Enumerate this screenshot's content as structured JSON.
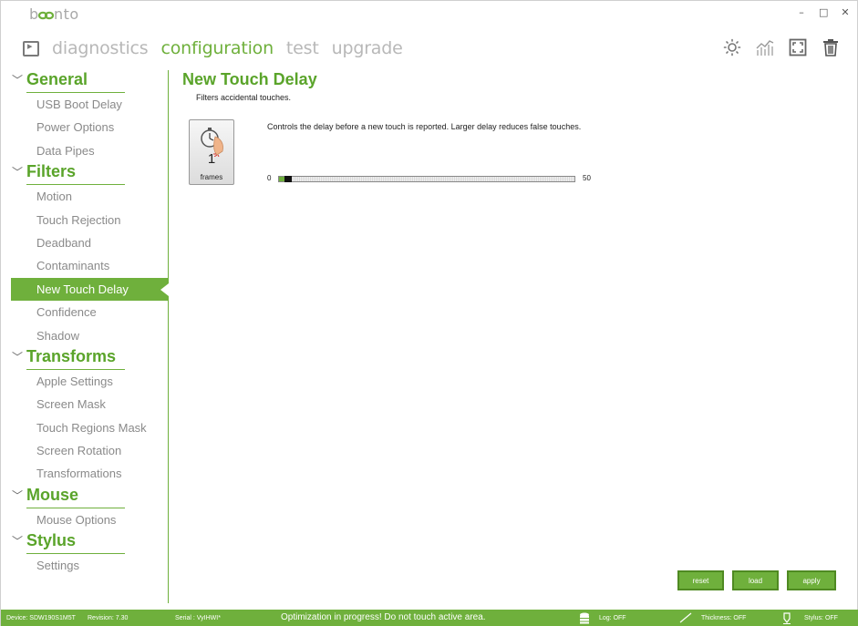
{
  "app": {
    "logo": "beento",
    "window_controls": {
      "minimize": "–",
      "maximize": "□",
      "close": "✕"
    }
  },
  "nav": {
    "tabs": [
      {
        "label": "diagnostics",
        "active": false
      },
      {
        "label": "configuration",
        "active": true
      },
      {
        "label": "test",
        "active": false
      },
      {
        "label": "upgrade",
        "active": false
      }
    ],
    "toolbar_icons": [
      "brightness-icon",
      "signal-chart-icon",
      "fullscreen-icon",
      "trash-icon"
    ]
  },
  "sidebar": {
    "groups": [
      {
        "title": "General",
        "items": [
          "USB Boot Delay",
          "Power Options",
          "Data Pipes"
        ]
      },
      {
        "title": "Filters",
        "items": [
          "Motion",
          "Touch Rejection",
          "Deadband",
          "Contaminants",
          "New Touch Delay",
          "Confidence",
          "Shadow"
        ]
      },
      {
        "title": "Transforms",
        "items": [
          "Apple Settings",
          "Screen Mask",
          "Touch Regions Mask",
          "Screen Rotation",
          "Transformations"
        ]
      },
      {
        "title": "Mouse",
        "items": [
          "Mouse Options"
        ]
      },
      {
        "title": "Stylus",
        "items": [
          "Settings"
        ]
      }
    ],
    "active_item": "New Touch Delay"
  },
  "page": {
    "title": "New Touch Delay",
    "subtitle": "Filters accidental touches.",
    "setting": {
      "value": "1",
      "unit": "frames",
      "description": "Controls the delay before a new touch is reported.  Larger delay reduces false touches.",
      "slider_min": "0",
      "slider_max": "50",
      "slider_value": 1
    }
  },
  "actions": {
    "reset": "reset",
    "load": "load",
    "apply": "apply"
  },
  "status": {
    "device": "Device: SDW190S1M5T",
    "revision": "Revision: 7.30",
    "serial": "Serial : VyIHWI*",
    "message": "Optimization in progress! Do not touch active area.",
    "log": "Log: OFF",
    "thickness": "Thickness: OFF",
    "stylus": "Stylus: OFF"
  },
  "colors": {
    "accent": "#6fb03c",
    "accent_dark": "#4f8a22",
    "muted_text": "#8a8a8a"
  }
}
